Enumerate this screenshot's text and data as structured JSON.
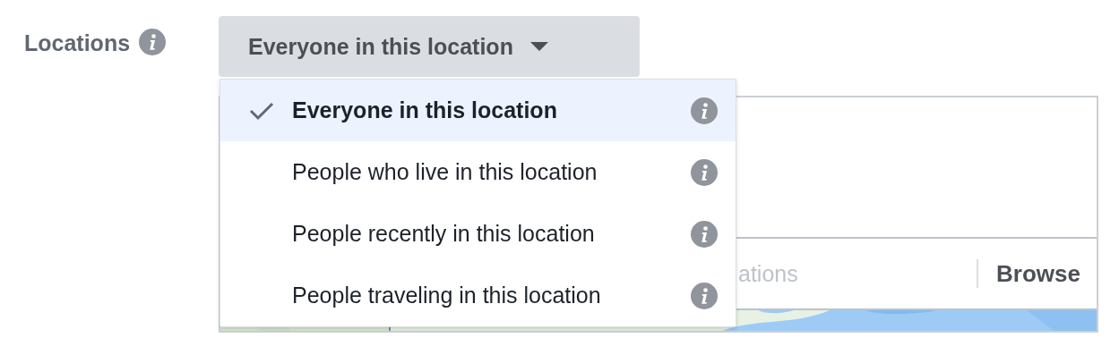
{
  "field": {
    "label": "Locations"
  },
  "dropdown": {
    "value": "Everyone in this location",
    "expanded": true
  },
  "menu": [
    {
      "label": "Everyone in this location",
      "selected": true
    },
    {
      "label": "People who live in this location",
      "selected": false
    },
    {
      "label": "People recently in this location",
      "selected": false
    },
    {
      "label": "People traveling in this location",
      "selected": false
    }
  ],
  "search": {
    "placeholder": "ations",
    "browse": "Browse"
  }
}
